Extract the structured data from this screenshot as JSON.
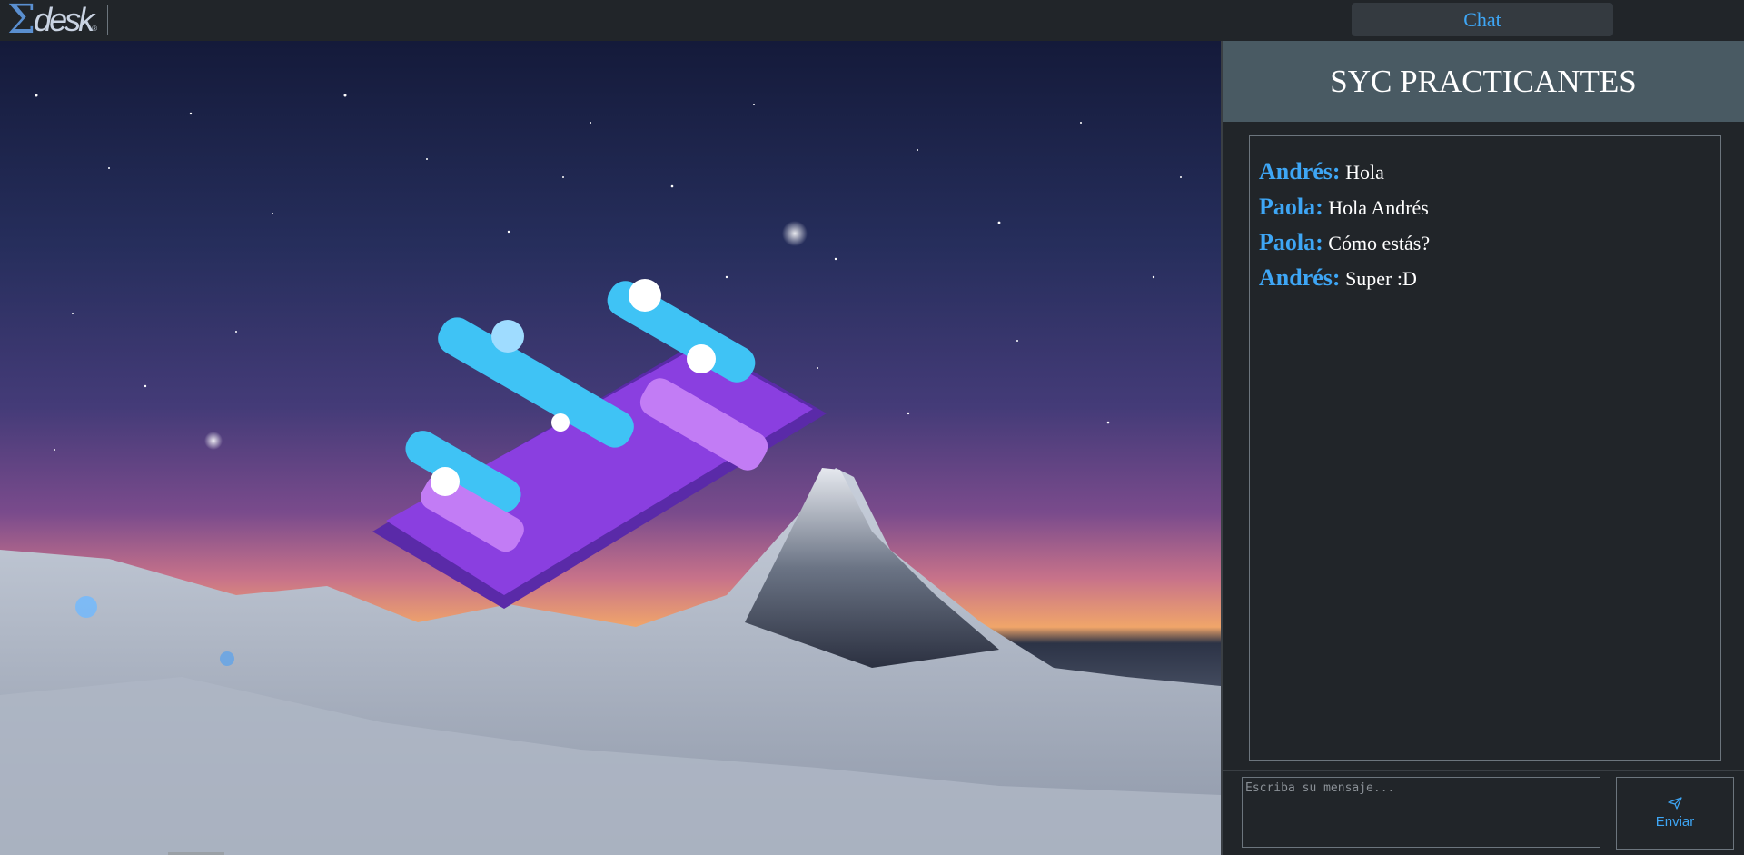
{
  "logo": {
    "sigma": "Σ",
    "word": "desk",
    "reg": "®"
  },
  "topbar": {
    "chat_tab": "Chat"
  },
  "panel": {
    "title": "SYC PRACTICANTES",
    "messages": [
      {
        "author": "Andrés:",
        "text": "Hola"
      },
      {
        "author": "Paola:",
        "text": "Hola Andrés"
      },
      {
        "author": "Paola:",
        "text": "Cómo estás?"
      },
      {
        "author": "Andrés:",
        "text": "Super :D"
      }
    ],
    "input": {
      "placeholder": "Escriba su mensaje...",
      "value": ""
    },
    "send_label": "Enviar",
    "send_icon": "paper-plane-icon"
  },
  "colors": {
    "accent": "#3ea6f5",
    "header_bg": "#495a63",
    "panel_bg": "#212529"
  }
}
